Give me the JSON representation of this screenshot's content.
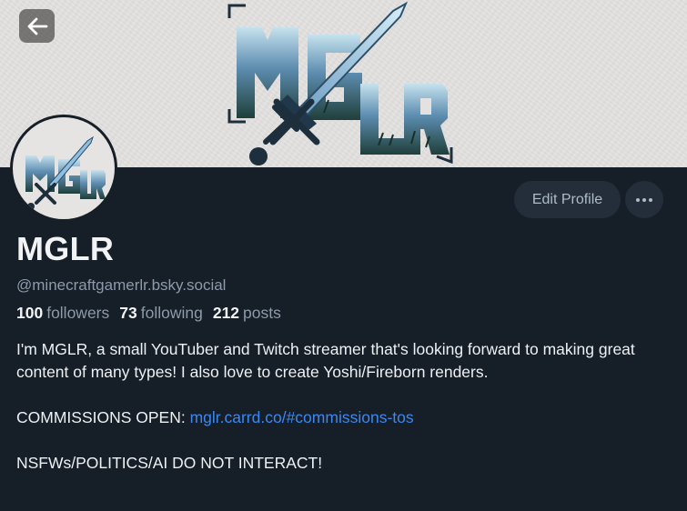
{
  "banner": {
    "logo_text": "MGLR"
  },
  "avatar": {
    "logo_text": "MGLR"
  },
  "header": {
    "back_icon": "arrow-left-icon"
  },
  "actions": {
    "edit_profile_label": "Edit Profile",
    "more_icon": "ellipsis-icon"
  },
  "profile": {
    "display_name": "MGLR",
    "handle": "@minecraftgamerlr.bsky.social"
  },
  "stats": {
    "followers_count": "100",
    "followers_label": "followers",
    "following_count": "73",
    "following_label": "following",
    "posts_count": "212",
    "posts_label": "posts"
  },
  "bio": {
    "line1": "I'm MGLR, a small YouTuber and Twitch streamer that's looking forward to making great content of many types! I also love to create Yoshi/Fireborn renders.",
    "commissions_prefix": "COMMISSIONS OPEN: ",
    "commissions_link": "mglr.carrd.co/#commissions-tos",
    "notice": "NSFWs/POLITICS/AI DO NOT INTERACT!"
  },
  "colors": {
    "background": "#161e27",
    "button_bg": "#232e3a",
    "muted_text": "#8d9aab",
    "link": "#3c88ee",
    "logo_blue": "#3d6e9a"
  }
}
